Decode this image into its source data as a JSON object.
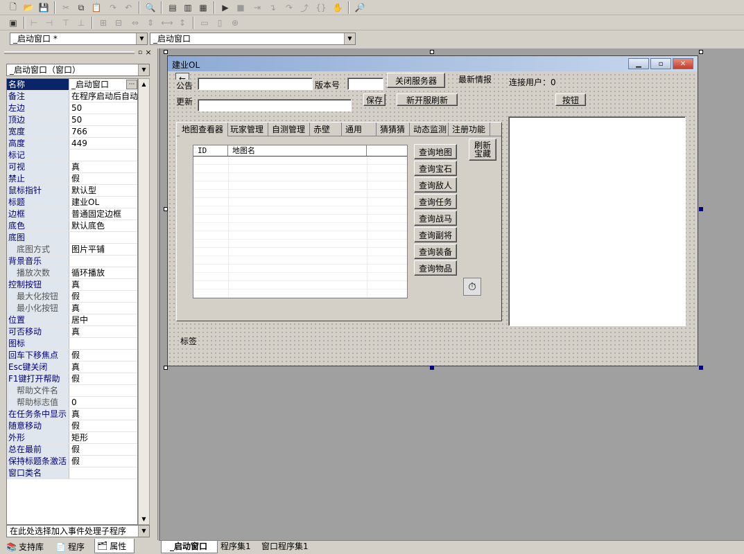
{
  "toolbar1": {
    "icons": [
      "new-file-icon",
      "open-folder-icon",
      "save-icon",
      "cut-icon",
      "copy-icon",
      "paste-icon",
      "redo-icon",
      "undo-icon",
      "find-icon",
      "layout-1-icon",
      "layout-2-icon",
      "layout-3-icon",
      "run-icon",
      "stop-icon",
      "step-icon",
      "step-into-icon",
      "step-over-icon",
      "step-out-icon",
      "breakpoint-icon",
      "hand-icon",
      "debug-icon"
    ]
  },
  "combo_left": {
    "value": "_启动窗口 *"
  },
  "combo_right": {
    "value": "_启动窗口"
  },
  "panel": {
    "object_selector": "_启动窗口（窗口）",
    "event_selector": "在此处选择加入事件处理子程序",
    "properties": [
      {
        "name": "名称",
        "value": "_启动窗口",
        "selected": true
      },
      {
        "name": "备注",
        "value": "在程序启动后自动"
      },
      {
        "name": "左边",
        "value": "50"
      },
      {
        "name": "顶边",
        "value": "50"
      },
      {
        "name": "宽度",
        "value": "766"
      },
      {
        "name": "高度",
        "value": "449"
      },
      {
        "name": "标记",
        "value": ""
      },
      {
        "name": "可视",
        "value": "真"
      },
      {
        "name": "禁止",
        "value": "假"
      },
      {
        "name": "鼠标指针",
        "value": "默认型"
      },
      {
        "name": "标题",
        "value": "建业OL"
      },
      {
        "name": "边框",
        "value": "普通固定边框"
      },
      {
        "name": "底色",
        "value": "默认底色"
      },
      {
        "name": "底图",
        "value": ""
      },
      {
        "name": "底图方式",
        "value": "图片平铺",
        "sub": true
      },
      {
        "name": "背景音乐",
        "value": ""
      },
      {
        "name": "播放次数",
        "value": "循环播放",
        "sub": true
      },
      {
        "name": "控制按钮",
        "value": "真"
      },
      {
        "name": "最大化按钮",
        "value": "假",
        "sub": true
      },
      {
        "name": "最小化按钮",
        "value": "真",
        "sub": true
      },
      {
        "name": "位置",
        "value": "居中"
      },
      {
        "name": "可否移动",
        "value": "真"
      },
      {
        "name": "图标",
        "value": ""
      },
      {
        "name": "回车下移焦点",
        "value": "假"
      },
      {
        "name": "Esc键关闭",
        "value": "真"
      },
      {
        "name": "F1键打开帮助",
        "value": "假"
      },
      {
        "name": "帮助文件名",
        "value": "",
        "sub": true
      },
      {
        "name": "帮助标志值",
        "value": "0",
        "sub": true
      },
      {
        "name": "在任务条中显示",
        "value": "真"
      },
      {
        "name": "随意移动",
        "value": "假"
      },
      {
        "name": "外形",
        "value": "矩形"
      },
      {
        "name": "总在最前",
        "value": "假"
      },
      {
        "name": "保持标题条激活",
        "value": "假"
      },
      {
        "name": "窗口类名",
        "value": ""
      }
    ],
    "tabs": [
      "支持库",
      "程序",
      "属性"
    ]
  },
  "form": {
    "title": "建业OL",
    "labels": {
      "notice": "公告",
      "version": "版本号",
      "news": "最新情报",
      "users": "连接用户：0",
      "update": "更新",
      "status": "标签"
    },
    "buttons": {
      "close_server": "关闭服务器",
      "save": "保存",
      "new_refresh": "新开服刷新",
      "button": "按钮",
      "refresh_treasure": "刷新宝藏"
    },
    "tabs": [
      "地图查看器",
      "玩家管理",
      "自测管理",
      "赤壁",
      "通用",
      "猜猜猜",
      "动态监测",
      "注册功能"
    ],
    "grid_columns": [
      "ID",
      "地图名"
    ],
    "query_buttons": [
      "查询地图",
      "查询宝石",
      "查询敌人",
      "查询任务",
      "查询战马",
      "查询副将",
      "查询装备",
      "查询物品"
    ]
  },
  "bottom_tabs": [
    "_启动窗口",
    "程序集1",
    "窗口程序集1"
  ]
}
